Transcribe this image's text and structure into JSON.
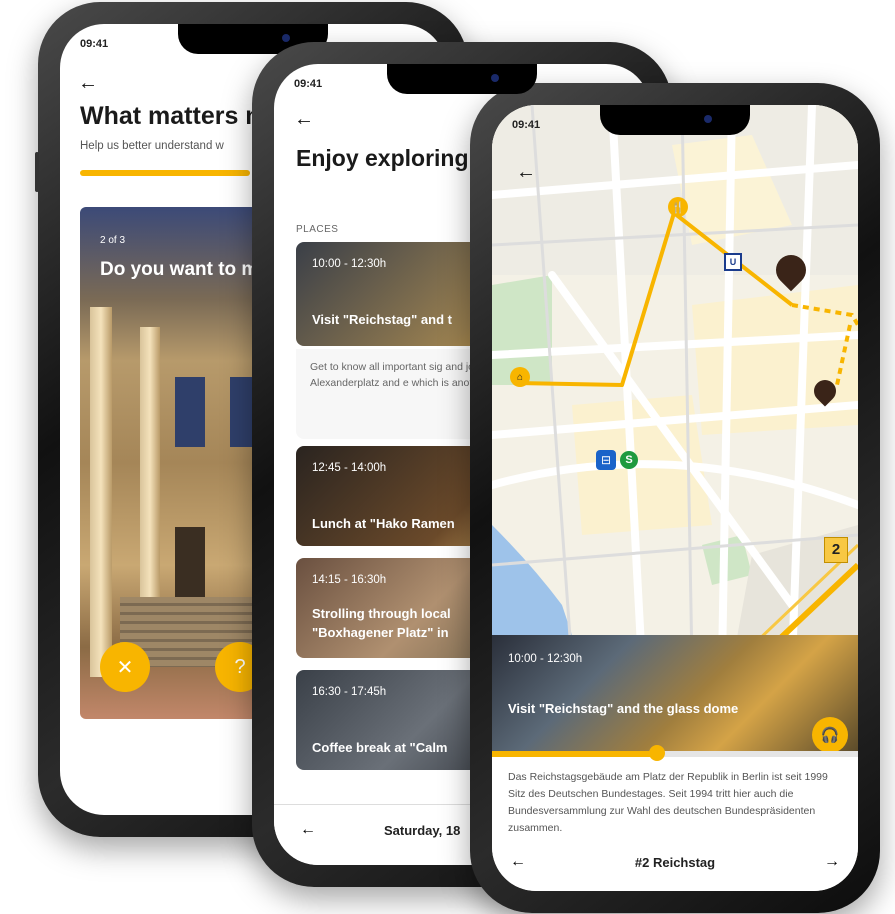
{
  "status_time": "09:41",
  "phone1": {
    "title": "What matters m",
    "subtitle": "Help us better understand w",
    "card_count": "2 of 3",
    "card_question": "Do you want to museums?",
    "reject_icon": "close-icon",
    "help_icon": "question-icon"
  },
  "phone2": {
    "title": "Enjoy exploring us!",
    "section_label": "PLACES",
    "places": [
      {
        "time": "10:00 - 12:30h",
        "name": "Visit \"Reichstag\" and t"
      },
      {
        "time": "12:45 - 14:00h",
        "name": "Lunch at \"Hako Ramen"
      },
      {
        "time": "14:15 - 16:30h",
        "name": "Strolling through local \"Boxhagener Platz\" in"
      },
      {
        "time": "16:30 - 17:45h",
        "name": "Coffee break at \"Calm"
      }
    ],
    "description": "Get to know all important sig and join us in exploring the r start at Alexanderplatz and e which is another transportati",
    "footer_date": "Saturday, 18"
  },
  "phone3": {
    "map_badge": "2",
    "place_time": "10:00 - 12:30h",
    "place_name": "Visit \"Reichstag\" and the glass dome",
    "progress": 0.45,
    "description": "Das Reichstagsgebäude am Platz der Republik in Berlin ist seit 1999 Sitz des Deutschen Bundestages. Seit 1994 tritt hier auch die Bundesversammlung zur Wahl des deutschen Bundespräsidenten zusammen.",
    "footer_title": "#2 Reichstag"
  },
  "colors": {
    "accent": "#f8b500",
    "route": "#f8b500"
  }
}
